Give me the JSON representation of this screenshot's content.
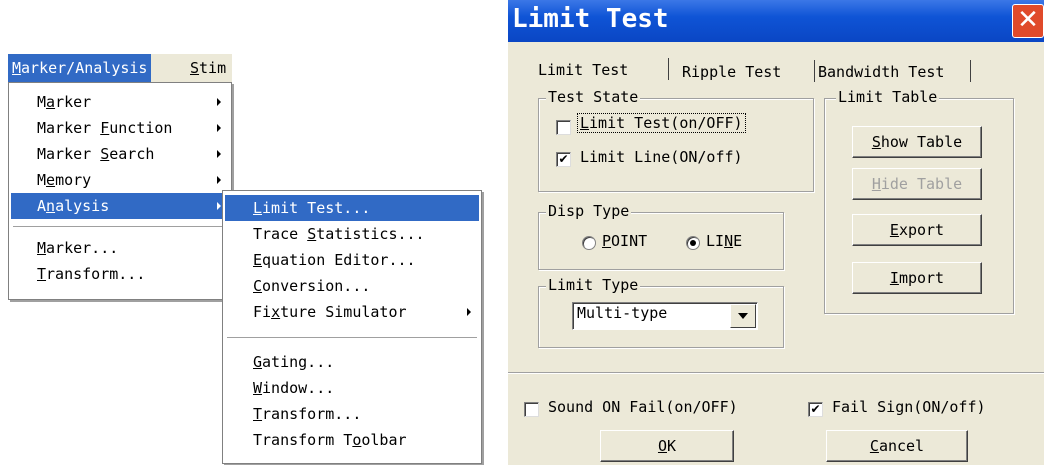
{
  "menubar": {
    "items": [
      {
        "label": "Marker/Analysis",
        "mnemonic": "M",
        "rest": "arker/Analysis"
      },
      {
        "label": "Stim",
        "mnemonic": "S",
        "rest": "tim"
      }
    ]
  },
  "main_menu": {
    "items": [
      {
        "pre": "M",
        "mn": "a",
        "post": "rker"
      },
      {
        "pre": "Marker ",
        "mn": "F",
        "post": "unction"
      },
      {
        "pre": "Marker ",
        "mn": "S",
        "post": "earch"
      },
      {
        "pre": "M",
        "mn": "e",
        "post": "mory"
      },
      {
        "pre": "A",
        "mn": "n",
        "post": "alysis"
      },
      {
        "pre": "",
        "mn": "M",
        "post": "arker..."
      },
      {
        "pre": "",
        "mn": "T",
        "post": "ransform..."
      }
    ]
  },
  "analysis_menu": {
    "items": [
      {
        "pre": "",
        "mn": "L",
        "post": "imit Test..."
      },
      {
        "pre": "Trace ",
        "mn": "S",
        "post": "tatistics..."
      },
      {
        "pre": "",
        "mn": "E",
        "post": "quation Editor..."
      },
      {
        "pre": "",
        "mn": "C",
        "post": "onversion..."
      },
      {
        "pre": "Fi",
        "mn": "x",
        "post": "ture Simulator"
      },
      {
        "pre": "",
        "mn": "G",
        "post": "ating..."
      },
      {
        "pre": "",
        "mn": "W",
        "post": "indow..."
      },
      {
        "pre": "",
        "mn": "T",
        "post": "ransform..."
      },
      {
        "pre": "Transform T",
        "mn": "o",
        "post": "olbar"
      }
    ]
  },
  "dialog": {
    "title": "Limit Test",
    "close_glyph": "✕",
    "tabs": [
      "Limit Test",
      "Ripple Test",
      "Bandwidth Test"
    ],
    "test_state": {
      "label": "Test State",
      "limit_test": {
        "mn": "L",
        "post": "imit Test(on/OFF)",
        "checked": false
      },
      "limit_line": {
        "label": "Limit Line(ON/off)",
        "checked": true
      }
    },
    "limit_table": {
      "label": "Limit Table",
      "show": {
        "mn": "S",
        "post": "how Table"
      },
      "hide": {
        "mn": "H",
        "post": "ide Table"
      },
      "export": {
        "mn": "E",
        "post": "xport"
      },
      "import": {
        "mn": "I",
        "post": "mport"
      }
    },
    "disp_type": {
      "label": "Disp Type",
      "point": {
        "mn": "P",
        "post": "OINT"
      },
      "line": {
        "pre": "LI",
        "mn": "N",
        "post": "E"
      },
      "selected": "LINE"
    },
    "limit_type": {
      "label": "Limit Type",
      "value": "Multi-type"
    },
    "sound_on_fail": {
      "label": "Sound ON Fail(on/OFF)",
      "checked": false
    },
    "fail_sign": {
      "label": "Fail Sign(ON/off)",
      "checked": true
    },
    "ok": {
      "mn": "O",
      "post": "K"
    },
    "cancel": {
      "mn": "C",
      "post": "ancel"
    }
  }
}
